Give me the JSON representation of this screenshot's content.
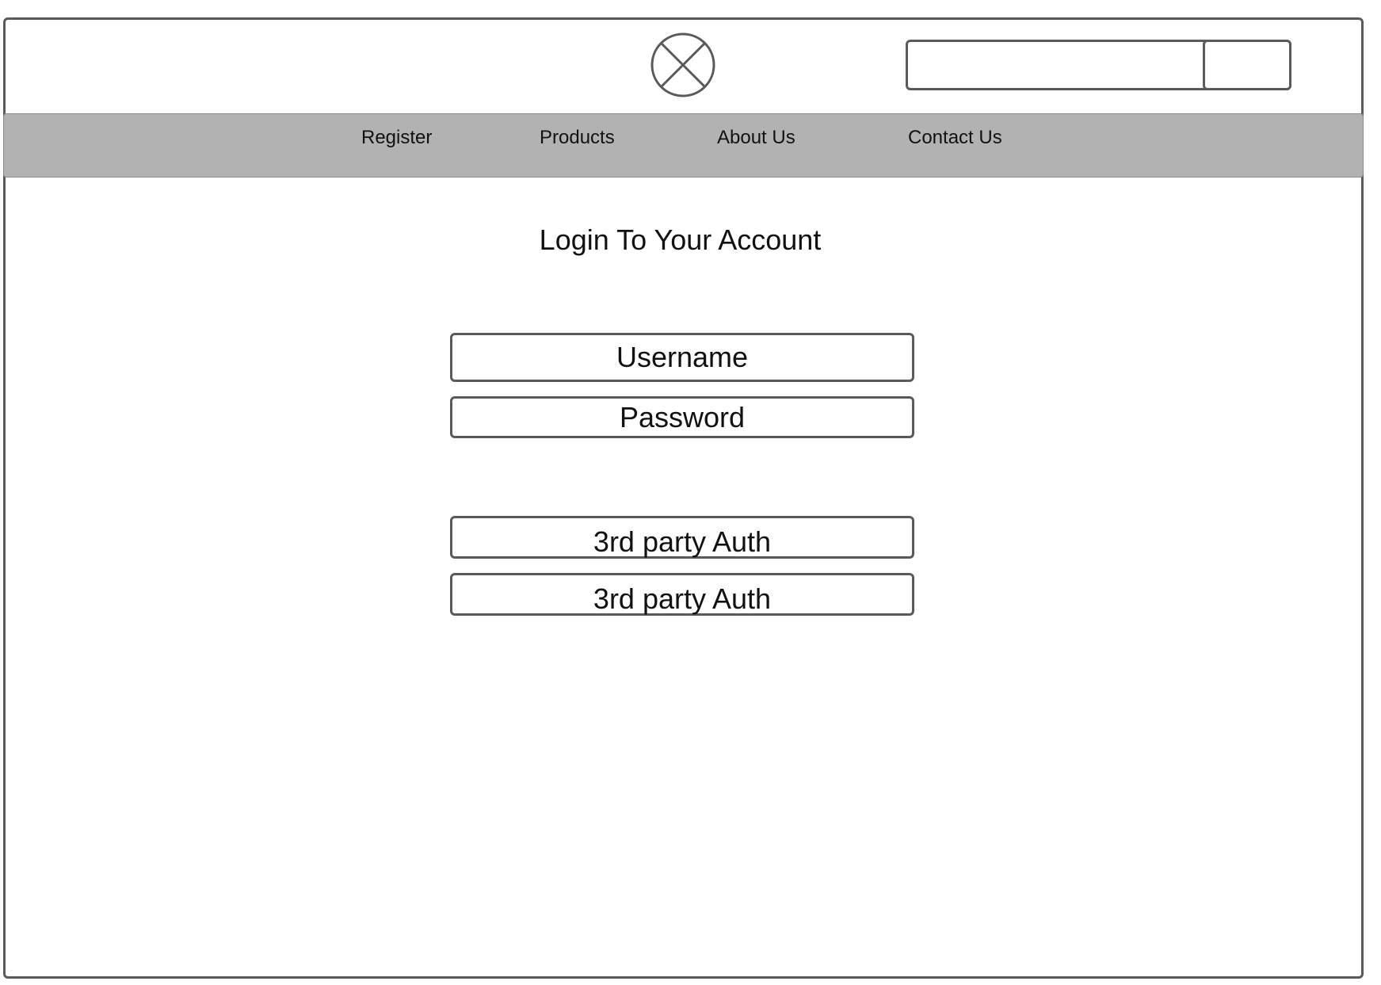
{
  "header": {
    "logo_icon": "placeholder-x-circle-icon",
    "search": {
      "value": "",
      "placeholder": "",
      "button_label": ""
    }
  },
  "nav": {
    "items": [
      {
        "label": "Register"
      },
      {
        "label": "Products"
      },
      {
        "label": "About Us"
      },
      {
        "label": "Contact Us"
      }
    ]
  },
  "main": {
    "title": "Login To Your Account",
    "username_placeholder": "Username",
    "password_placeholder": "Password",
    "auth_buttons": [
      {
        "label": "3rd party Auth"
      },
      {
        "label": "3rd party Auth"
      }
    ]
  },
  "colors": {
    "border": "#5a5a5a",
    "nav_background": "#b2b2b2",
    "text": "#111111",
    "background": "#ffffff"
  }
}
